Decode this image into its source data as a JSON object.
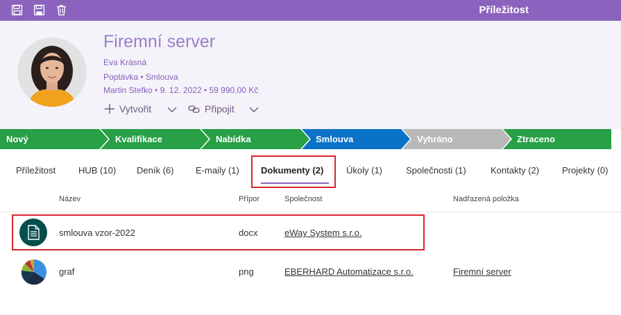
{
  "topbar": {
    "title": "Příležitost",
    "tools": [
      "save-icon",
      "save-close-icon",
      "delete-icon"
    ]
  },
  "header": {
    "title": "Firemní server",
    "contact": "Eva Krásná",
    "type_line": "Poptávka • Smlouva",
    "meta_line": "Martin Stefko • 9. 12. 2022 • 59 990,00 Kč",
    "create_label": "Vytvořit",
    "connect_label": "Připojit"
  },
  "stages": [
    {
      "label": "Nový",
      "color": "#27a046"
    },
    {
      "label": "Kvalifikace",
      "color": "#27a046"
    },
    {
      "label": "Nabídka",
      "color": "#27a046"
    },
    {
      "label": "Smlouva",
      "color": "#0a72c8"
    },
    {
      "label": "Vyhráno",
      "color": "#b9b9b9"
    },
    {
      "label": "Ztraceno",
      "color": "#27a046"
    }
  ],
  "tabs": [
    {
      "label": "Příležitost"
    },
    {
      "label": "HUB (10)"
    },
    {
      "label": "Deník (6)"
    },
    {
      "label": "E-maily (1)"
    },
    {
      "label": "Dokumenty (2)",
      "active": true
    },
    {
      "label": "Úkoly (1)"
    },
    {
      "label": "Společnosti (1)"
    },
    {
      "label": "Kontakty (2)"
    },
    {
      "label": "Projekty (0)"
    }
  ],
  "table": {
    "columns": [
      "Název",
      "Přípor",
      "Společnost",
      "Nadřazená položka"
    ],
    "rows": [
      {
        "icon": "document-icon",
        "name": "smlouva vzor-2022",
        "ext": "docx",
        "company": "eWay System s.r.o.",
        "parent": ""
      },
      {
        "icon": "pie-chart-icon",
        "name": "graf",
        "ext": "png",
        "company": "EBERHARD Automatizace s.r.o.",
        "parent": "Firemní server"
      }
    ]
  }
}
